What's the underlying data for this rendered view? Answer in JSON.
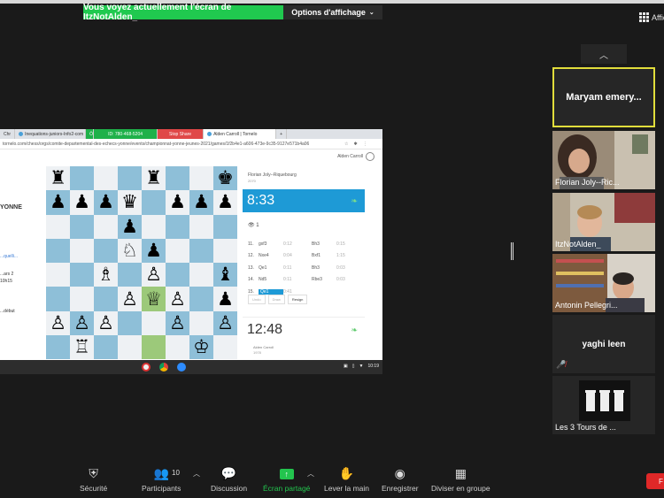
{
  "top": {
    "share_banner": "Vous voyez actuellement l'écran de ItzNotAlden_",
    "view_options": "Options d'affichage",
    "view_toggle": "Affic"
  },
  "shared_screen": {
    "tabs": [
      {
        "label": "Chr"
      },
      {
        "label": "Inequations-juniors-Info2-com"
      },
      {
        "label": "Ö"
      },
      {
        "label": "ID: 780-468-5204"
      },
      {
        "label": "Stop Share"
      },
      {
        "label": "Alden Carroll | Tornelo"
      },
      {
        "label": "+"
      }
    ],
    "url": "tornelo.com/chess/orgs/comite-departemental-des-echecs-yonne/events/championnat-yonne-jeunes-2021/games/1f2b4e1-a606-473e-9c35-9127e571b4a06",
    "user_name": "Alden Carroll",
    "left_texts": {
      "t1": "YONNE",
      "t2": "...quelli...",
      "t3": "...ars 2",
      "t4": "10h15",
      "t5": "...début"
    },
    "board": [
      [
        "♜",
        "",
        "",
        "",
        "♜",
        "",
        "",
        "♚"
      ],
      [
        "♟",
        "♟",
        "♟",
        "♛",
        "",
        "♟",
        "♟",
        "♟"
      ],
      [
        "",
        "",
        "",
        "♟",
        "",
        "",
        "",
        ""
      ],
      [
        "",
        "",
        "",
        "♘",
        "♟",
        "",
        "",
        ""
      ],
      [
        "",
        "",
        "♗",
        "",
        "♙",
        "",
        "",
        "♝"
      ],
      [
        "",
        "",
        "",
        "♙",
        "♕",
        "♙",
        "",
        "♟"
      ],
      [
        "♙",
        "♙",
        "♙",
        "",
        "",
        "♙",
        "",
        "♙"
      ],
      [
        "",
        "♖",
        "",
        "",
        "",
        "",
        "♔",
        ""
      ]
    ],
    "highlight_squares": [
      "5-4",
      "7-4"
    ],
    "opponent": "Florian Joly--Riquebourg",
    "opponent_rating": "2070",
    "clock_top": "8:33",
    "viewers": "1",
    "moves": [
      {
        "n": "11.",
        "w": "gxf3",
        "wt": "0:12",
        "b": "Bh3",
        "bt": "0:15"
      },
      {
        "n": "12.",
        "w": "Nxe4",
        "wt": "0:04",
        "b": "Bxf1",
        "bt": "1:15"
      },
      {
        "n": "13.",
        "w": "Qe1",
        "wt": "0:11",
        "b": "Bh3",
        "bt": "0:03"
      },
      {
        "n": "14.",
        "w": "Nd5",
        "wt": "0:11",
        "b": "Rbe3",
        "bt": "0:03"
      },
      {
        "n": "15.",
        "w": "Qe1",
        "wt": "0:41",
        "b": "",
        "bt": ""
      }
    ],
    "actions": [
      "Undo",
      "Draw",
      "Resign"
    ],
    "clock_bottom": "12:48",
    "me": "Alden Carroll",
    "me_rating": "1978",
    "tray_time": "10:19"
  },
  "participants": [
    {
      "name": "Maryam emery...",
      "active": true
    },
    {
      "name": "Florian Joly--Ric..."
    },
    {
      "name": "ItzNotAlden_"
    },
    {
      "name": "Antonin Pellegri..."
    },
    {
      "name": "yaghi leen",
      "muted": true
    },
    {
      "name": "Les 3 Tours de ..."
    }
  ],
  "toolbar": {
    "security": "Sécurité",
    "participants": "Participants",
    "participants_count": "10",
    "chat": "Discussion",
    "share": "Écran partagé",
    "raise_hand": "Lever la main",
    "record": "Enregistrer",
    "breakout": "Diviser en groupe",
    "end": "F"
  },
  "colors": {
    "share_green": "#20c94f",
    "active_border": "#e1dd3b",
    "clock_blue": "#1e9ad6",
    "end_red": "#e02828"
  }
}
